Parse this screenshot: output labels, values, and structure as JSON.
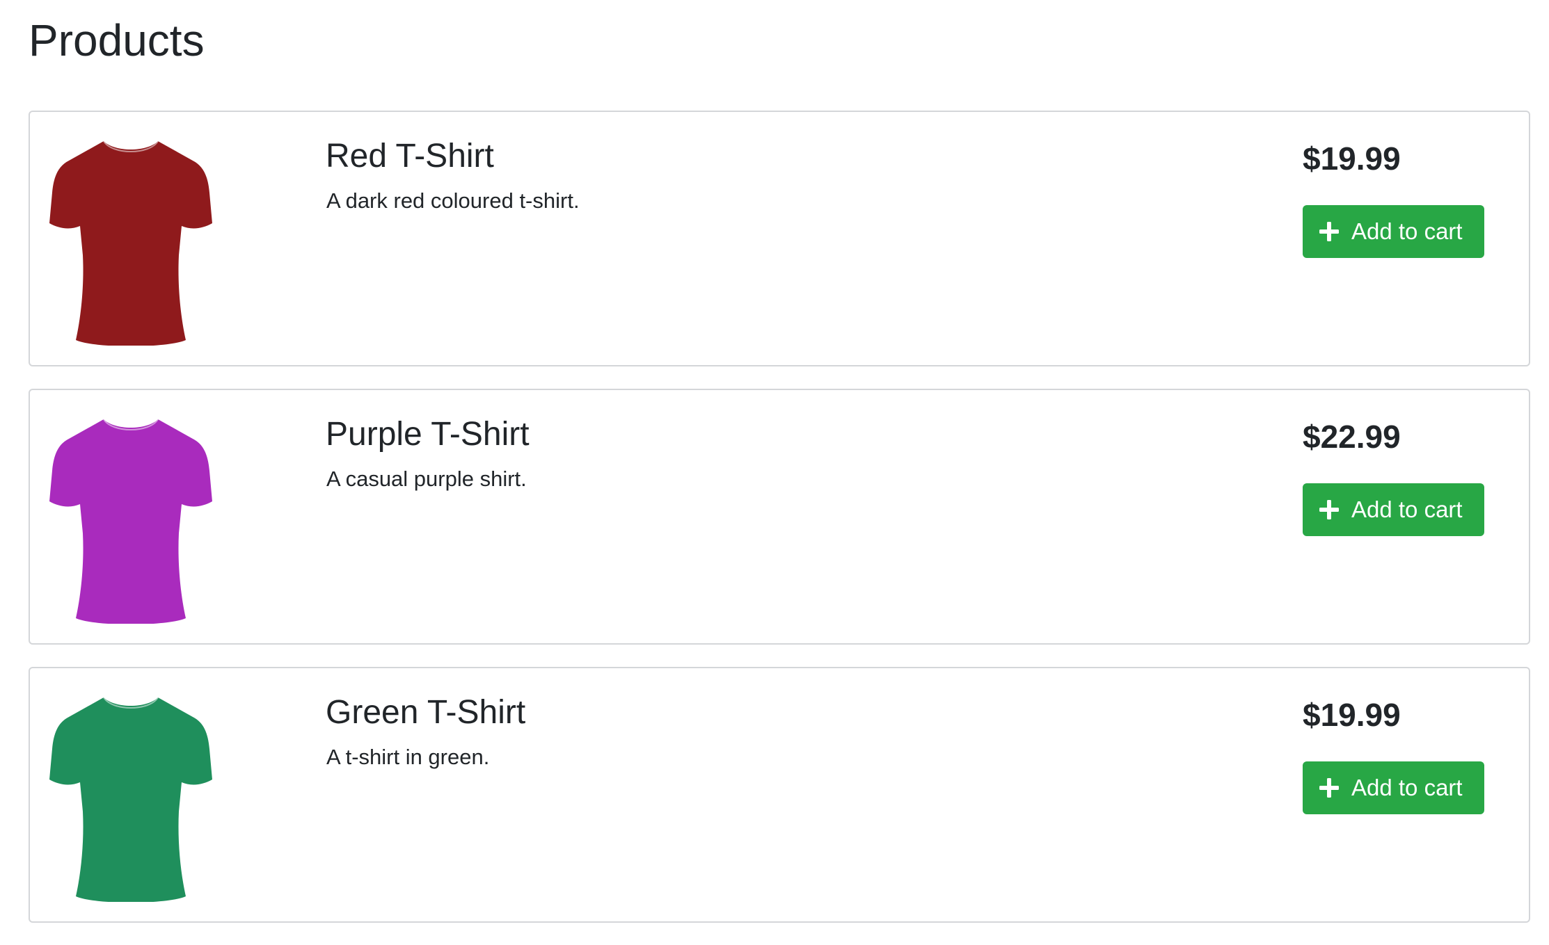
{
  "page": {
    "title": "Products"
  },
  "products": [
    {
      "name": "Red T-Shirt",
      "description": "A dark red coloured t-shirt.",
      "price": "$19.99",
      "button_label": "Add to cart",
      "button_icon": "plus-icon",
      "image_icon": "tshirt-icon",
      "shirt_color": "#8f1a1c"
    },
    {
      "name": "Purple T-Shirt",
      "description": "A casual purple shirt.",
      "price": "$22.99",
      "button_label": "Add to cart",
      "button_icon": "plus-icon",
      "image_icon": "tshirt-icon",
      "shirt_color": "#a92bbd"
    },
    {
      "name": "Green T-Shirt",
      "description": "A t-shirt in green.",
      "price": "$19.99",
      "button_label": "Add to cart",
      "button_icon": "plus-icon",
      "image_icon": "tshirt-icon",
      "shirt_color": "#1f8f5c"
    }
  ],
  "colors": {
    "button_bg": "#28a745",
    "button_text": "#ffffff",
    "card_border": "#d4d6d9",
    "text": "#212529"
  }
}
